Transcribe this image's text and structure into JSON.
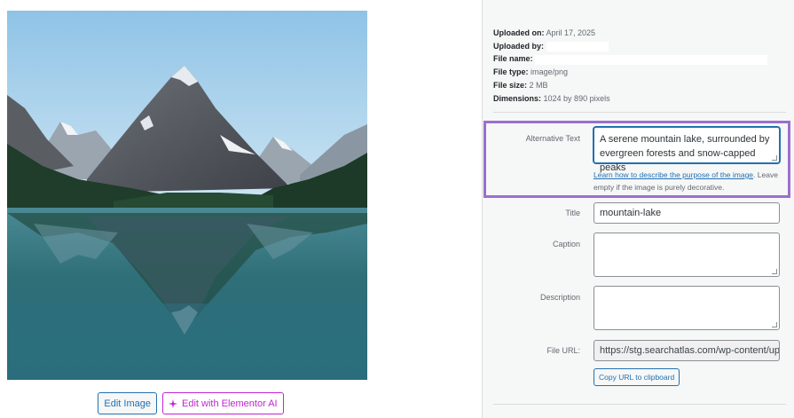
{
  "media": {
    "edit_image_label": "Edit Image",
    "edit_ai_label": "Edit with Elementor AI"
  },
  "meta": {
    "uploaded_on_label": "Uploaded on:",
    "uploaded_on_value": "April 17, 2025",
    "uploaded_by_label": "Uploaded by:",
    "uploaded_by_value": "",
    "file_name_label": "File name:",
    "file_name_value": "",
    "file_type_label": "File type:",
    "file_type_value": "image/png",
    "file_size_label": "File size:",
    "file_size_value": "2 MB",
    "dimensions_label": "Dimensions:",
    "dimensions_value": "1024 by 890 pixels"
  },
  "fields": {
    "alt_label": "Alternative Text",
    "alt_value": "A serene mountain lake, surrounded by evergreen forests and snow-capped peaks",
    "alt_help_link": "Learn how to describe the purpose of the image",
    "alt_help_rest": ". Leave empty if the image is purely decorative.",
    "title_label": "Title",
    "title_value": "mountain-lake",
    "caption_label": "Caption",
    "caption_value": "",
    "description_label": "Description",
    "description_value": "",
    "file_url_label": "File URL:",
    "file_url_value": "https://stg.searchatlas.com/wp-content/uploads/",
    "copy_url_label": "Copy URL to clipboard"
  },
  "colors": {
    "accent": "#2271b1",
    "ai_accent": "#c026d3",
    "highlight": "#9b6fcf"
  }
}
